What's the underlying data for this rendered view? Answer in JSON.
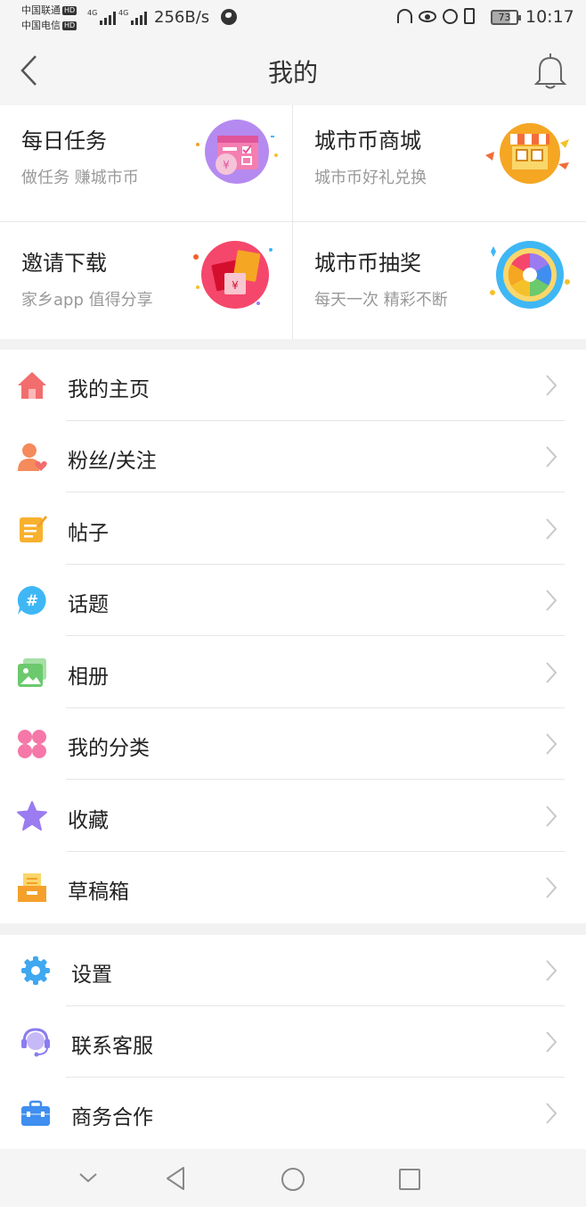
{
  "status_bar": {
    "carrier1": "中国联通",
    "carrier2": "中国电信",
    "hd_badge": "HD",
    "net_type": "4G",
    "net_speed": "256B/s",
    "battery": "73",
    "time": "10:17"
  },
  "header": {
    "title": "我的"
  },
  "grid": [
    {
      "title": "每日任务",
      "subtitle": "做任务 赚城市币",
      "icon": "calendar-coin-icon"
    },
    {
      "title": "城市币商城",
      "subtitle": "城市币好礼兑换",
      "icon": "shop-icon"
    },
    {
      "title": "邀请下载",
      "subtitle": "家乡app 值得分享",
      "icon": "red-envelope-icon"
    },
    {
      "title": "城市币抽奖",
      "subtitle": "每天一次 精彩不断",
      "icon": "prize-wheel-icon"
    }
  ],
  "menu": [
    {
      "label": "我的主页",
      "icon": "home-icon",
      "color": "#f26d6d"
    },
    {
      "label": "粉丝/关注",
      "icon": "user-heart-icon",
      "color": "#f58a5c"
    },
    {
      "label": "帖子",
      "icon": "post-icon",
      "color": "#f8b12e"
    },
    {
      "label": "话题",
      "icon": "hashtag-icon",
      "color": "#3fb7f5"
    },
    {
      "label": "相册",
      "icon": "photo-icon",
      "color": "#6cc96c"
    },
    {
      "label": "我的分类",
      "icon": "category-icon",
      "color": "#f578a8"
    },
    {
      "label": "收藏",
      "icon": "star-icon",
      "color": "#9a7bf0"
    },
    {
      "label": "草稿箱",
      "icon": "drafts-icon",
      "color": "#f5a02a"
    }
  ],
  "menu2": [
    {
      "label": "设置",
      "icon": "gear-icon",
      "color": "#3fa8f0"
    },
    {
      "label": "联系客服",
      "icon": "headset-icon",
      "color": "#8a7cf0"
    },
    {
      "label": "商务合作",
      "icon": "briefcase-icon",
      "color": "#3f8ef0"
    }
  ]
}
